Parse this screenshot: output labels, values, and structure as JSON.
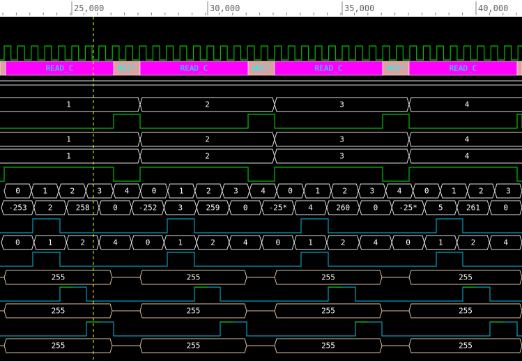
{
  "ruler": {
    "labels": [
      "25,000",
      "30,000",
      "35,000",
      "40,000"
    ]
  },
  "colors": {
    "background": "#000000",
    "ruler_bg": "#ffffff",
    "clock": "#00c000",
    "signal_blue": "#00a0c0",
    "bus_white": "#e0e0e0",
    "bus_tan": "#e0c0a0",
    "state_magenta": "#ff00ff",
    "state_alt": "#e0a0a0",
    "bus_text": "#ffffff",
    "state_text": "#00ffff",
    "cursor": "#ffff00"
  },
  "state_bus": {
    "main_label": "READ_C",
    "alt_label": "WRI*"
  },
  "rows": [
    {
      "kind": "clock",
      "name": "clock-signal"
    },
    {
      "kind": "state",
      "name": "state-bus"
    },
    {
      "kind": "blank",
      "name": "blank-bus"
    },
    {
      "kind": "bus",
      "name": "bus-count-a",
      "values": [
        "1",
        "2",
        "3",
        "4"
      ]
    },
    {
      "kind": "pulse",
      "name": "pulse-green-a"
    },
    {
      "kind": "bus",
      "name": "bus-count-b",
      "values": [
        "1",
        "2",
        "3",
        "4"
      ]
    },
    {
      "kind": "bus",
      "name": "bus-count-c",
      "values": [
        "1",
        "2",
        "3",
        "4"
      ]
    },
    {
      "kind": "pulse",
      "name": "pulse-green-b"
    },
    {
      "kind": "bus",
      "name": "bus-index",
      "values": [
        "0",
        "1",
        "2",
        "3",
        "4",
        "0",
        "1",
        "2",
        "3",
        "4",
        "0",
        "1",
        "2",
        "3",
        "4",
        "0",
        "1",
        "2",
        "3"
      ]
    },
    {
      "kind": "bus",
      "name": "bus-value",
      "values": [
        "-253",
        "2",
        "258",
        "0",
        "-252",
        "3",
        "259",
        "0",
        "-25*",
        "4",
        "260",
        "0",
        "-25*",
        "5",
        "261",
        "0"
      ]
    },
    {
      "kind": "pulse",
      "name": "pulse-blue-a"
    },
    {
      "kind": "bus",
      "name": "bus-mixed",
      "values": [
        "0",
        "1",
        "2",
        "4",
        "0",
        "1",
        "2",
        "4",
        "0",
        "1",
        "2",
        "4",
        "0",
        "1",
        "2",
        "4"
      ]
    },
    {
      "kind": "pulse",
      "name": "pulse-blue-b"
    },
    {
      "kind": "bus",
      "name": "bus-255-a",
      "values": [
        "255",
        "255",
        "255",
        "255"
      ]
    },
    {
      "kind": "pulse",
      "name": "pulse-mixed-a"
    },
    {
      "kind": "bus",
      "name": "bus-255-b",
      "values": [
        "255",
        "255",
        "255",
        "255"
      ]
    },
    {
      "kind": "pulse",
      "name": "pulse-mixed-b"
    },
    {
      "kind": "bus",
      "name": "bus-255-c",
      "values": [
        "255",
        "255",
        "255",
        "255"
      ]
    }
  ]
}
